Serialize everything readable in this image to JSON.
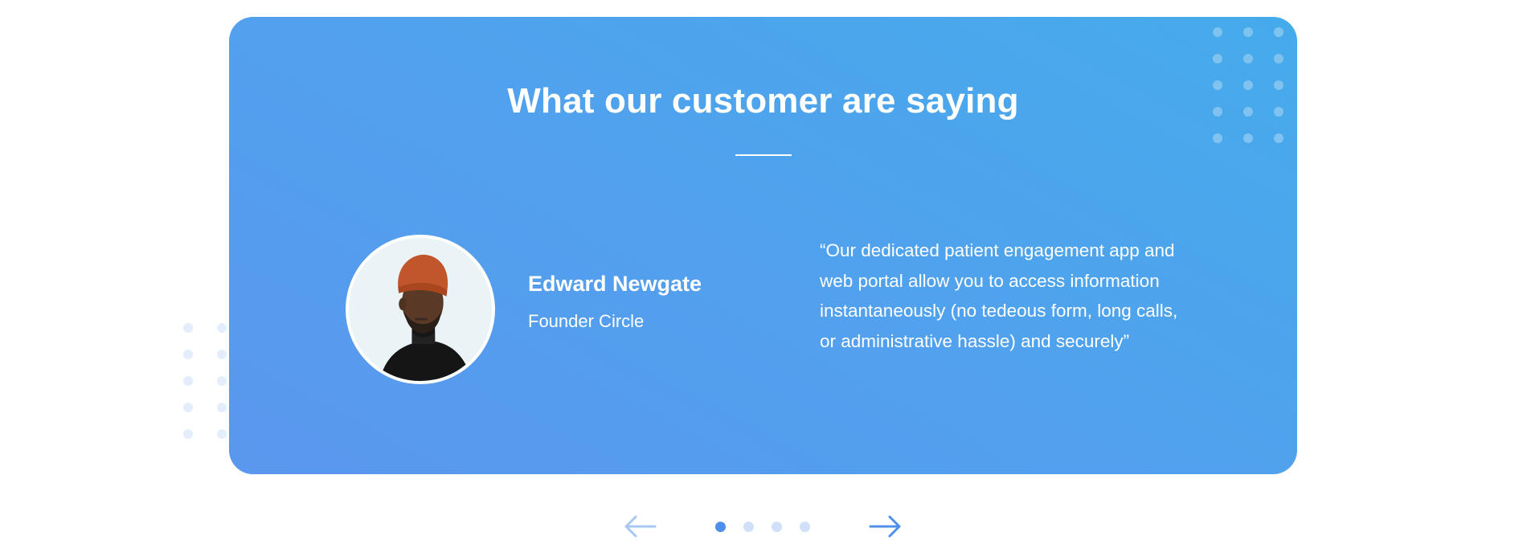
{
  "testimonials": {
    "heading": "What our customer are saying",
    "current": {
      "name": "Edward Newgate",
      "role": "Founder Circle",
      "quote": "“Our dedicated patient engagement app and web portal allow you to access information instantaneously (no tedeous form, long calls, or administrative hassle) and securely”"
    },
    "carousel": {
      "slide_count": 4,
      "active_index": 0
    }
  },
  "icons": {
    "prev": "arrow-left-icon",
    "next": "arrow-right-icon"
  },
  "colors": {
    "card_gradient_start": "#5a97ee",
    "card_gradient_end": "#46abea",
    "indicator_active": "#4e90ea",
    "indicator_inactive": "#cfe0f8",
    "arrow_prev": "#a8c8f4",
    "arrow_next": "#4e90ea"
  }
}
